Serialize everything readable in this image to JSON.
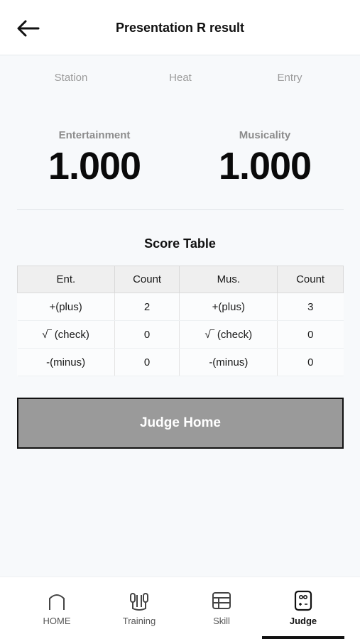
{
  "header": {
    "title": "Presentation R result",
    "back_icon": "arrow-left-icon"
  },
  "meta": {
    "station": "Station",
    "heat": "Heat",
    "entry": "Entry"
  },
  "scores": {
    "entertainment": {
      "label": "Entertainment",
      "value": "1.000"
    },
    "musicality": {
      "label": "Musicality",
      "value": "1.000"
    }
  },
  "score_table": {
    "title": "Score Table",
    "headers": [
      "Ent.",
      "Count",
      "Mus.",
      "Count"
    ],
    "rows": [
      [
        "+(plus)",
        "2",
        "+(plus)",
        "3"
      ],
      [
        "√‾ (check)",
        "0",
        "√‾ (check)",
        "0"
      ],
      [
        "-(minus)",
        "0",
        "-(minus)",
        "0"
      ]
    ]
  },
  "actions": {
    "judge_home": "Judge Home"
  },
  "nav": {
    "items": [
      {
        "label": "HOME",
        "icon": "home-icon"
      },
      {
        "label": "Training",
        "icon": "jump-rope-icon"
      },
      {
        "label": "Skill",
        "icon": "table-icon"
      },
      {
        "label": "Judge",
        "icon": "judge-device-icon"
      }
    ],
    "active": "Judge"
  },
  "colors": {
    "background": "#f7f9fb",
    "button": "#9a9a9a",
    "text": "#111111",
    "muted": "#9a9a9a"
  }
}
